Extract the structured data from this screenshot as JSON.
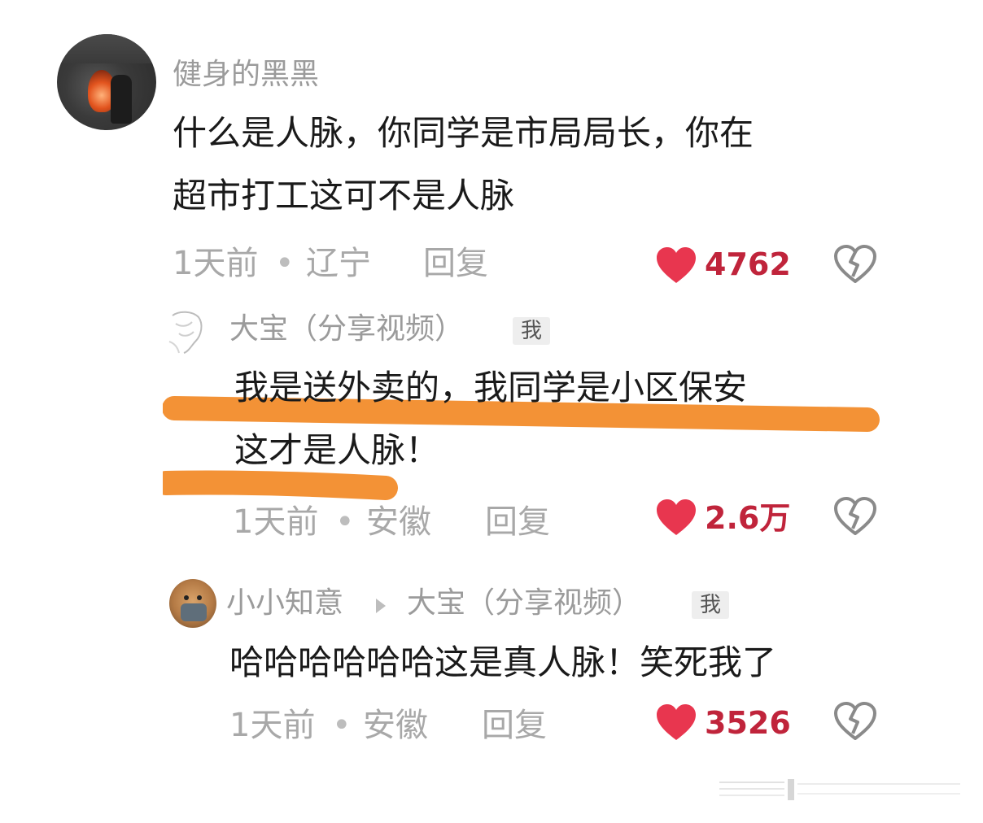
{
  "comment": {
    "username": "健身的黑黑",
    "text_line1": "什么是人脉，你同学是市局局长，你在",
    "text_line2": "超市打工这可不是人脉",
    "time": "1天前",
    "location": "辽宁",
    "reply_label": "回复",
    "likes": "4762"
  },
  "reply1": {
    "username": "大宝（分享视频）",
    "badge": "我",
    "text_line1": "我是送外卖的，我同学是小区保安",
    "text_line2": "这才是人脉！",
    "time": "1天前",
    "location": "安徽",
    "reply_label": "回复",
    "likes": "2.6万"
  },
  "reply2": {
    "username": "小小知意",
    "reply_to": "大宝（分享视频）",
    "badge": "我",
    "text": "哈哈哈哈哈哈这是真人脉！笑死我了",
    "time": "1天前",
    "location": "安徽",
    "reply_label": "回复",
    "likes": "3526"
  },
  "separator": "•",
  "colors": {
    "heart": "#e8364f",
    "like_text": "#c0243b",
    "highlight_marker": "#f39236",
    "meta_gray": "#a8a8a8"
  },
  "icons": {
    "like": "heart-icon",
    "dislike": "broken-heart-icon"
  }
}
